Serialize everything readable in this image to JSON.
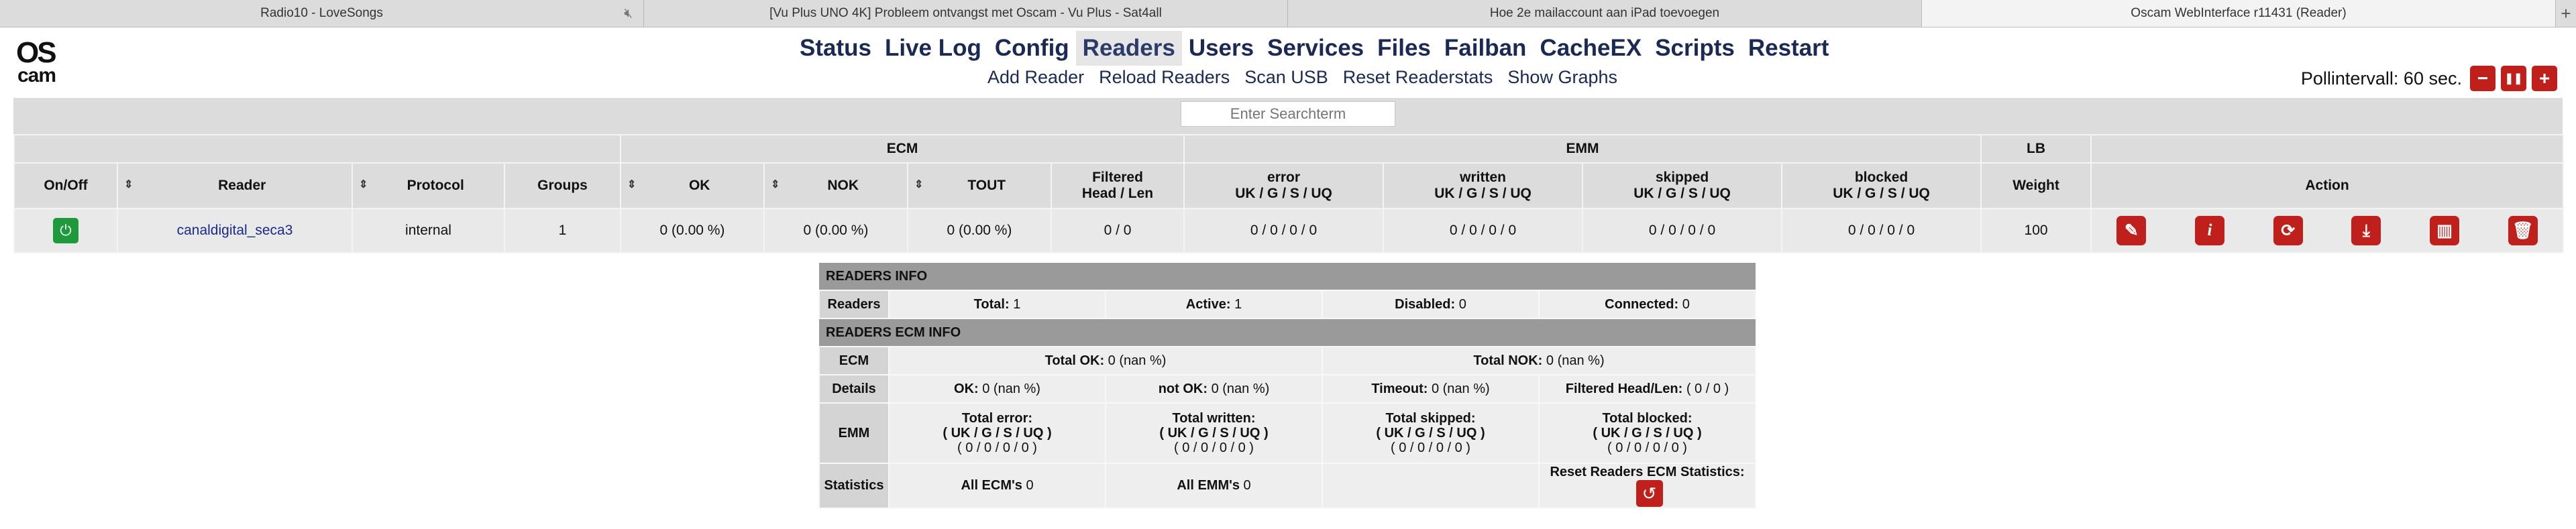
{
  "browser": {
    "tabs": [
      {
        "title": "Radio10 - LoveSongs",
        "muted_icon": "speaker-muted-icon",
        "active": false
      },
      {
        "title": "[Vu Plus UNO 4K] Probleem ontvangst met Oscam - Vu Plus - Sat4all",
        "active": false
      },
      {
        "title": "Hoe 2e mailaccount aan iPad toevoegen",
        "active": false
      },
      {
        "title": "Oscam WebInterface r11431 (Reader)",
        "active": true
      }
    ],
    "new_tab_label": "+"
  },
  "logo": {
    "line1": "OS",
    "line2": "cam"
  },
  "nav": {
    "items": [
      "Status",
      "Live Log",
      "Config",
      "Readers",
      "Users",
      "Services",
      "Files",
      "Failban",
      "CacheEX",
      "Scripts",
      "Restart"
    ],
    "active": "Readers"
  },
  "subnav": [
    "Add Reader",
    "Reload Readers",
    "Scan USB",
    "Reset Readerstats",
    "Show Graphs"
  ],
  "poll": {
    "label": "Pollintervall: 60 sec.",
    "minus": "−",
    "pause": "❚❚",
    "plus": "+"
  },
  "search": {
    "placeholder": "Enter Searchterm"
  },
  "readers_table": {
    "groups": {
      "ecm": "ECM",
      "emm": "EMM",
      "lb": "LB"
    },
    "headers": {
      "onoff": "On/Off",
      "reader": "Reader",
      "protocol": "Protocol",
      "groups": "Groups",
      "ok": "OK",
      "nok": "NOK",
      "tout": "TOUT",
      "filtered_1": "Filtered",
      "filtered_2": "Head / Len",
      "error_1": "error",
      "written_1": "written",
      "skipped_1": "skipped",
      "blocked_1": "blocked",
      "emm_sub": "UK / G / S / UQ",
      "weight": "Weight",
      "action": "Action"
    },
    "row": {
      "reader": "canaldigital_seca3",
      "protocol": "internal",
      "groups": "1",
      "ok": "0 (0.00 %)",
      "nok": "0 (0.00 %)",
      "tout": "0 (0.00 %)",
      "filtered": "0 / 0",
      "error": "0 / 0 / 0 / 0",
      "written": "0 / 0 / 0 / 0",
      "skipped": "0 / 0 / 0 / 0",
      "blocked": "0 / 0 / 0 / 0",
      "weight": "100"
    },
    "action_icons": [
      "edit-icon",
      "info-icon",
      "refresh-icon",
      "download-icon",
      "stats-icon",
      "delete-icon"
    ]
  },
  "info": {
    "readers_info_title": "READERS INFO",
    "readers_label": "Readers",
    "total_label": "Total:",
    "total": "1",
    "active_label": "Active:",
    "active": "1",
    "disabled_label": "Disabled:",
    "disabled": "0",
    "connected_label": "Connected:",
    "connected": "0",
    "ecm_info_title": "READERS ECM INFO",
    "ecm_label": "ECM",
    "total_ok_label": "Total OK:",
    "total_ok": "0 (nan %)",
    "total_nok_label": "Total NOK:",
    "total_nok": "0 (nan %)",
    "details_label": "Details",
    "ok_label": "OK:",
    "ok": "0 (nan %)",
    "notok_label": "not OK:",
    "notok": "0 (nan %)",
    "timeout_label": "Timeout:",
    "timeout": "0 (nan %)",
    "filtered_label": "Filtered Head/Len:",
    "filtered": "( 0 / 0 )",
    "emm_label": "EMM",
    "terr_label": "Total error:",
    "twri_label": "Total written:",
    "tski_label": "Total skipped:",
    "tblo_label": "Total blocked:",
    "emm_sub": "( UK / G / S / UQ )",
    "emm_vals": "( 0 / 0 / 0 / 0 )",
    "stats_label": "Statistics",
    "all_ecm_label": "All ECM's",
    "all_ecm": "0",
    "all_emm_label": "All EMM's",
    "all_emm": "0",
    "reset_label": "Reset Readers ECM Statistics:"
  }
}
